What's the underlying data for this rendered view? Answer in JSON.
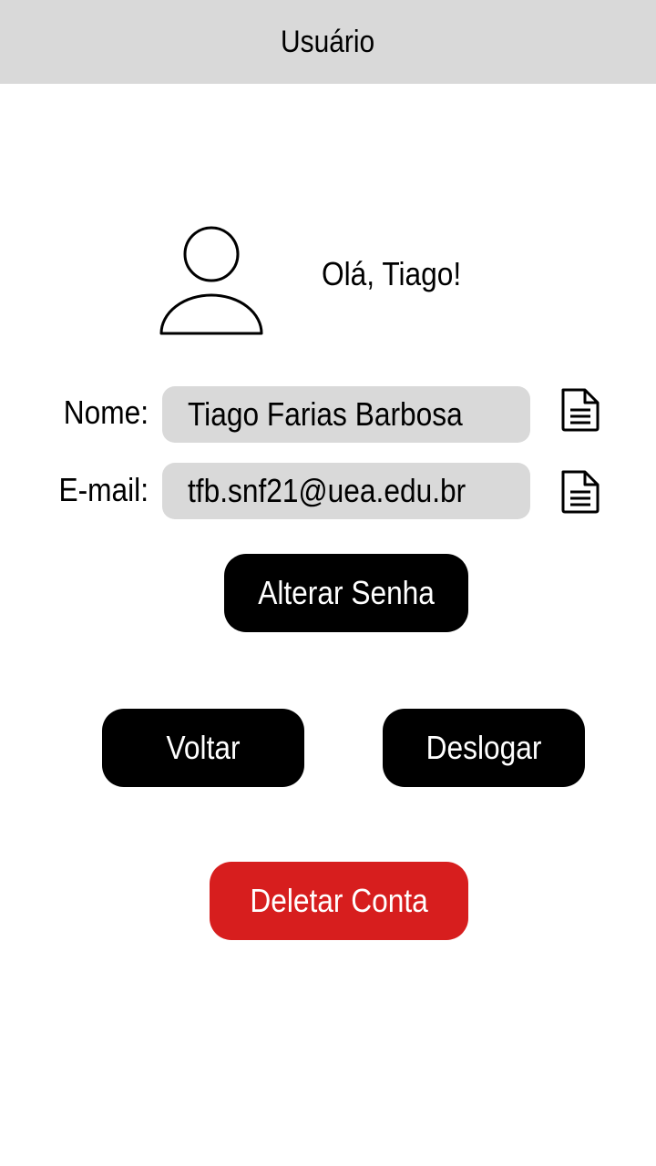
{
  "header": {
    "title": "Usuário"
  },
  "profile": {
    "greeting": "Olá, Tiago!"
  },
  "fields": {
    "name": {
      "label": "Nome:",
      "value": "Tiago Farias Barbosa"
    },
    "email": {
      "label": "E-mail:",
      "value": "tfb.snf21@uea.edu.br"
    }
  },
  "buttons": {
    "change_password": "Alterar Senha",
    "back": "Voltar",
    "logout": "Deslogar",
    "delete_account": "Deletar Conta"
  },
  "icons": {
    "avatar": "user-avatar-icon",
    "edit": "document-edit-icon"
  },
  "colors": {
    "header_bg": "#d9d9d9",
    "field_bg": "#d9d9d9",
    "primary_button": "#000000",
    "danger_button": "#d71e1e"
  }
}
